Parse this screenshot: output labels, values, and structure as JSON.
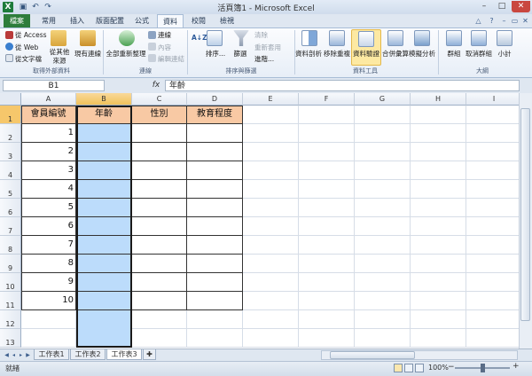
{
  "titlebar": {
    "title": "活頁簿1 - Microsoft Excel",
    "logo": "X",
    "qat": [
      "save-icon",
      "undo-icon",
      "redo-icon"
    ],
    "window_buttons": [
      "minimize-icon",
      "maximize-icon",
      "close-icon"
    ]
  },
  "ribbon_tabs": [
    "檔案",
    "常用",
    "插入",
    "版面配置",
    "公式",
    "資料",
    "校閱",
    "檢視"
  ],
  "active_tab": "資料",
  "ribbon": {
    "external_data": {
      "label": "取得外部資料",
      "from_access": "從 Access",
      "from_web": "從 Web",
      "from_text": "從文字檔",
      "from_other": "從其他",
      "from_other_sub": "來源",
      "existing": "現有連線"
    },
    "connections": {
      "label": "連線",
      "refresh_all": "全部重新整理",
      "connections": "連線",
      "properties": "內容",
      "edit_links": "編輯連結"
    },
    "sort_filter": {
      "label": "排序與篩選",
      "sort_az": "A↓Z",
      "sort": "排序...",
      "filter": "篩選",
      "clear": "清除",
      "reapply": "重新套用",
      "advanced": "進階..."
    },
    "data_tools": {
      "label": "資料工具",
      "text_to_columns": "資料剖析",
      "remove_duplicates": "移除重複",
      "validation": "資料驗證",
      "consolidate": "合併彙算",
      "what_if": "模擬分析"
    },
    "outline": {
      "label": "大綱",
      "group": "群組",
      "ungroup": "取消群組",
      "subtotal": "小計"
    }
  },
  "formula_bar": {
    "name_box": "B1",
    "fx": "fx",
    "content": "年齡"
  },
  "columns": [
    "A",
    "B",
    "C",
    "D",
    "E",
    "F",
    "G",
    "H",
    "I"
  ],
  "selected_column": "B",
  "rows": [
    "1",
    "2",
    "3",
    "4",
    "5",
    "6",
    "7",
    "8",
    "9",
    "10",
    "11",
    "12",
    "13"
  ],
  "table": {
    "headers": [
      "會員編號",
      "年齡",
      "性別",
      "教育程度"
    ],
    "member_ids": [
      "1",
      "2",
      "3",
      "4",
      "5",
      "6",
      "7",
      "8",
      "9",
      "10"
    ],
    "header_color": "#f8c9a4",
    "selection_color": "#bcdcfb"
  },
  "sheet_tabs": [
    "工作表1",
    "工作表2",
    "工作表3"
  ],
  "active_sheet": "工作表3",
  "status": {
    "text": "就緒",
    "zoom": "100%"
  }
}
